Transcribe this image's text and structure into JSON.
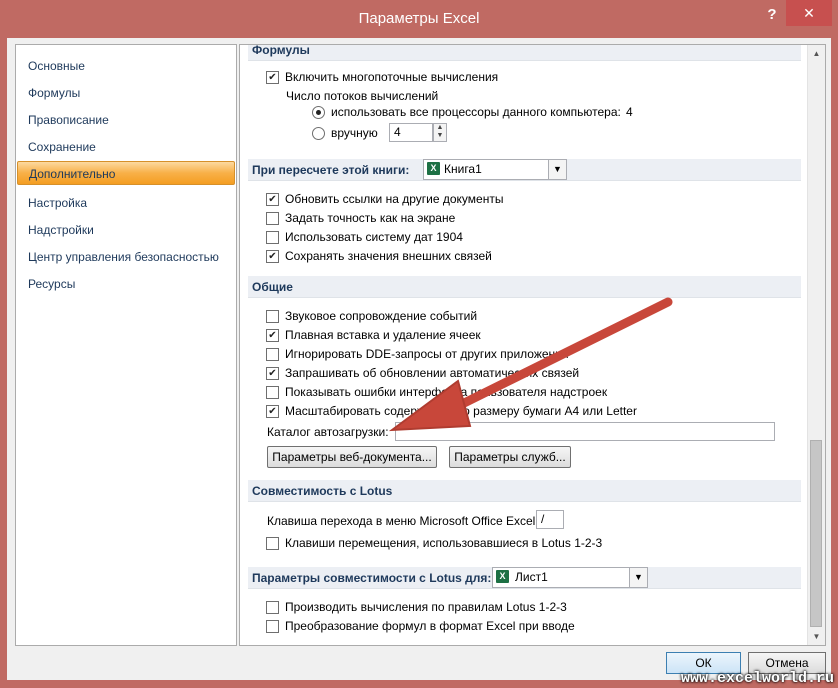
{
  "window": {
    "title": "Параметры Excel",
    "help": "?",
    "close": "✕"
  },
  "sidebar": {
    "items": [
      {
        "label": "Основные"
      },
      {
        "label": "Формулы"
      },
      {
        "label": "Правописание"
      },
      {
        "label": "Сохранение"
      },
      {
        "label": "Дополнительно"
      },
      {
        "label": "Настройка"
      },
      {
        "label": "Надстройки"
      },
      {
        "label": "Центр управления безопасностью"
      },
      {
        "label": "Ресурсы"
      }
    ],
    "active": "Дополнительно"
  },
  "formulas": {
    "header": "Формулы",
    "multithread": {
      "label": "Включить многопоточные вычисления",
      "checked": true
    },
    "threads_label": "Число потоков вычислений",
    "use_all": {
      "label": "использовать все процессоры данного компьютера:",
      "value": "4",
      "selected": true
    },
    "manual": {
      "label": "вручную",
      "value": "4",
      "selected": false
    }
  },
  "recalc": {
    "header": "При пересчете этой книги:",
    "workbook": "Книга1",
    "items": [
      {
        "label": "Обновить ссылки на другие документы",
        "checked": true
      },
      {
        "label": "Задать точность как на экране",
        "checked": false
      },
      {
        "label": "Использовать систему дат 1904",
        "checked": false
      },
      {
        "label": "Сохранять значения внешних связей",
        "checked": true
      }
    ]
  },
  "general": {
    "header": "Общие",
    "items": [
      {
        "label": "Звуковое сопровождение событий",
        "checked": false
      },
      {
        "label": "Плавная вставка и удаление ячеек",
        "checked": true
      },
      {
        "label": "Игнорировать DDE-запросы от других приложений",
        "checked": false
      },
      {
        "label": "Запрашивать об обновлении автоматических связей",
        "checked": true
      },
      {
        "label": "Показывать ошибки интерфейса пользователя надстроек",
        "checked": false
      },
      {
        "label": "Масштабировать содержимое по размеру бумаги A4 или Letter",
        "checked": true
      }
    ],
    "startup_label": "Каталог автозагрузки:",
    "startup_value": "",
    "web_options": "Параметры веб-документа...",
    "service_options": "Параметры служб..."
  },
  "lotus": {
    "header": "Совместимость с Lotus",
    "menu_key_label": "Клавиша перехода в меню Microsoft Office Excel:",
    "menu_key_value": "/",
    "nav_keys": {
      "label": "Клавиши перемещения, использовавшиеся в Lotus 1-2-3",
      "checked": false
    }
  },
  "lotus_settings": {
    "header": "Параметры совместимости с Lotus для:",
    "sheet": "Лист1",
    "items": [
      {
        "label": "Производить вычисления по правилам Lotus 1-2-3",
        "checked": false
      },
      {
        "label": "Преобразование формул в формат Excel при вводе",
        "checked": false
      }
    ]
  },
  "footer": {
    "ok": "ОК",
    "cancel": "Отмена"
  },
  "watermark": "www.excelworld.ru",
  "colors": {
    "titlebar": "#c06a63",
    "active_item": "#f8b048",
    "arrow": "#c8473a",
    "close_button": "#c7504f"
  }
}
